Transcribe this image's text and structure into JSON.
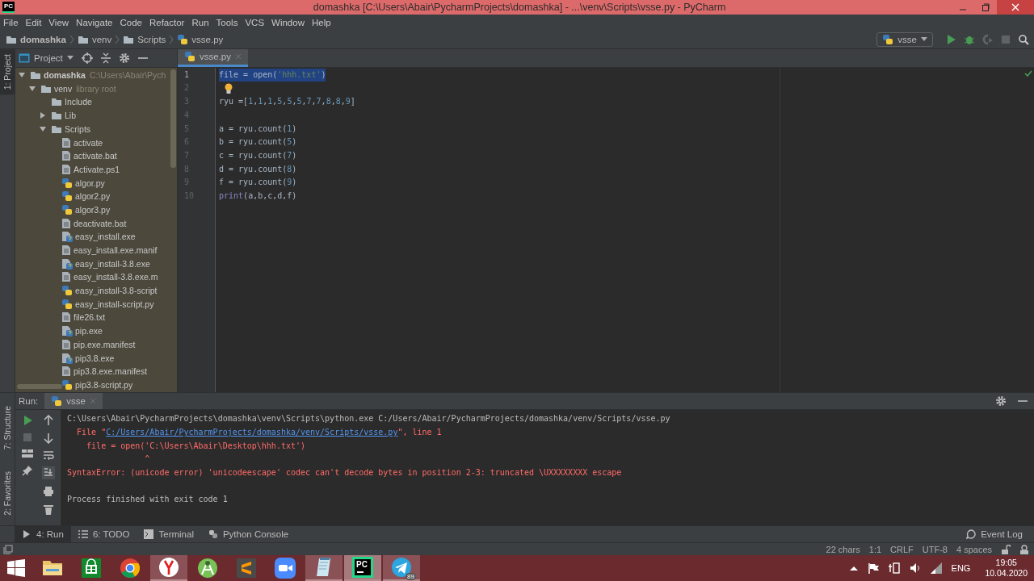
{
  "title_bar": {
    "app_label": "PC",
    "title": "domashka [C:\\Users\\Abair\\PycharmProjects\\domashka] - ...\\venv\\Scripts\\vsse.py - PyCharm"
  },
  "menu": [
    "File",
    "Edit",
    "View",
    "Navigate",
    "Code",
    "Refactor",
    "Run",
    "Tools",
    "VCS",
    "Window",
    "Help"
  ],
  "breadcrumb": [
    {
      "label": "domashka",
      "kind": "folder",
      "bold": true
    },
    {
      "label": "venv",
      "kind": "folder",
      "bold": false
    },
    {
      "label": "Scripts",
      "kind": "folder",
      "bold": false
    },
    {
      "label": "vsse.py",
      "kind": "python",
      "bold": false
    }
  ],
  "run_config": {
    "name": "vsse"
  },
  "side_tabs_top": [
    {
      "label": "1: Project",
      "selected": true
    }
  ],
  "project_panel": {
    "title": "Project",
    "tree": [
      {
        "label": "domashka",
        "kind": "folder",
        "bold": true,
        "note": "C:\\Users\\Abair\\Pych",
        "expanded": true,
        "children": [
          {
            "label": "venv",
            "kind": "folder",
            "bold": false,
            "note": "library root",
            "expanded": true,
            "children": [
              {
                "label": "Include",
                "kind": "folder",
                "bold": false
              },
              {
                "label": "Lib",
                "kind": "folder",
                "bold": false,
                "expanded": false
              },
              {
                "label": "Scripts",
                "kind": "folder",
                "bold": false,
                "expanded": true,
                "children": [
                  {
                    "label": "activate",
                    "kind": "text",
                    "bold": false
                  },
                  {
                    "label": "activate.bat",
                    "kind": "text",
                    "bold": false
                  },
                  {
                    "label": "Activate.ps1",
                    "kind": "text",
                    "bold": false
                  },
                  {
                    "label": "algor.py",
                    "kind": "python",
                    "bold": false
                  },
                  {
                    "label": "algor2.py",
                    "kind": "python",
                    "bold": false
                  },
                  {
                    "label": "algor3.py",
                    "kind": "python",
                    "bold": false
                  },
                  {
                    "label": "deactivate.bat",
                    "kind": "text",
                    "bold": false
                  },
                  {
                    "label": "easy_install.exe",
                    "kind": "exe",
                    "bold": false
                  },
                  {
                    "label": "easy_install.exe.manif",
                    "kind": "text",
                    "bold": false
                  },
                  {
                    "label": "easy_install-3.8.exe",
                    "kind": "exe",
                    "bold": false
                  },
                  {
                    "label": "easy_install-3.8.exe.m",
                    "kind": "text",
                    "bold": false
                  },
                  {
                    "label": "easy_install-3.8-script",
                    "kind": "python",
                    "bold": false
                  },
                  {
                    "label": "easy_install-script.py",
                    "kind": "python",
                    "bold": false
                  },
                  {
                    "label": "file26.txt",
                    "kind": "text",
                    "bold": false
                  },
                  {
                    "label": "pip.exe",
                    "kind": "exe",
                    "bold": false
                  },
                  {
                    "label": "pip.exe.manifest",
                    "kind": "text",
                    "bold": false
                  },
                  {
                    "label": "pip3.8.exe",
                    "kind": "exe",
                    "bold": false
                  },
                  {
                    "label": "pip3.8.exe.manifest",
                    "kind": "text",
                    "bold": false
                  },
                  {
                    "label": "pip3.8-script.py",
                    "kind": "python",
                    "bold": false
                  }
                ]
              }
            ]
          }
        ]
      }
    ]
  },
  "editor": {
    "tabs": [
      {
        "label": "vsse.py",
        "selected": true
      }
    ],
    "lines": [
      {
        "number": "1",
        "selected": true,
        "bulb": false,
        "segments": [
          {
            "text": "file = open(",
            "kind": "plain"
          },
          {
            "text": "'hhh.txt'",
            "kind": "string"
          },
          {
            "text": ")",
            "kind": "plain"
          }
        ]
      },
      {
        "number": "2",
        "selected": false,
        "bulb": true
      },
      {
        "number": "3",
        "selected": false,
        "bulb": false,
        "segments": [
          {
            "text": "ryu =[1,1,1,5,5,5,7,7,8,8,9]",
            "kind": "plain"
          }
        ]
      },
      {
        "number": "4",
        "selected": false,
        "bulb": false
      },
      {
        "number": "5",
        "selected": false,
        "bulb": false,
        "segments": [
          {
            "text": "a = ryu.count(1)",
            "kind": "plain"
          }
        ]
      },
      {
        "number": "6",
        "selected": false,
        "bulb": false,
        "segments": [
          {
            "text": "b = ryu.count(5)",
            "kind": "plain"
          }
        ]
      },
      {
        "number": "7",
        "selected": false,
        "bulb": false,
        "segments": [
          {
            "text": "c = ryu.count(7)",
            "kind": "plain"
          }
        ]
      },
      {
        "number": "8",
        "selected": false,
        "bulb": false,
        "segments": [
          {
            "text": "d = ryu.count(8)",
            "kind": "plain"
          }
        ]
      },
      {
        "number": "9",
        "selected": false,
        "bulb": false,
        "segments": [
          {
            "text": "f = ryu.count(9)",
            "kind": "plain"
          }
        ]
      },
      {
        "number": "10",
        "selected": false,
        "bulb": false,
        "segments": [
          {
            "text": "print",
            "kind": "builtin"
          },
          {
            "text": "(a,b,c,d,f)",
            "kind": "plain"
          }
        ]
      }
    ]
  },
  "run_panel": {
    "label": "Run:",
    "tabs": [
      {
        "label": "vsse",
        "selected": true
      }
    ],
    "output": [
      {
        "kind": "plain",
        "segments": [
          {
            "text": "C:\\Users\\Abair\\PycharmProjects\\domashka\\venv\\Scripts\\python.exe C:/Users/Abair/PycharmProjects/domashka/venv/Scripts/vsse.py",
            "link": false
          }
        ]
      },
      {
        "kind": "error",
        "segments": [
          {
            "text": "  File \"",
            "link": false
          },
          {
            "text": "C:/Users/Abair/PycharmProjects/domashka/venv/Scripts/vsse.py",
            "link": true
          },
          {
            "text": "\", line 1",
            "link": false
          }
        ]
      },
      {
        "kind": "error",
        "segments": [
          {
            "text": "    file = open('C:\\Users\\Abair\\Desktop\\hhh.txt')",
            "link": false
          }
        ]
      },
      {
        "kind": "error",
        "segments": [
          {
            "text": "                ^",
            "link": false
          }
        ]
      },
      {
        "kind": "error",
        "segments": [
          {
            "text": "SyntaxError: (unicode error) 'unicodeescape' codec can't decode bytes in position 2-3: truncated \\UXXXXXXXX escape",
            "link": false
          }
        ]
      },
      {
        "kind": "blank"
      },
      {
        "kind": "plain",
        "segments": [
          {
            "text": "Process finished with exit code 1",
            "link": false
          }
        ]
      }
    ]
  },
  "side_tabs_bottom": [
    {
      "label": "7: Structure",
      "selected": false
    },
    {
      "label": "2: Favorites",
      "selected": false
    }
  ],
  "tool_tabs": [
    {
      "label": "4: Run",
      "kind": "run",
      "selected": true
    },
    {
      "label": "6: TODO",
      "kind": "todo",
      "selected": false
    },
    {
      "label": "Terminal",
      "kind": "terminal",
      "selected": false
    },
    {
      "label": "Python Console",
      "kind": "console",
      "selected": false
    }
  ],
  "event_log": "Event Log",
  "status_bar": [
    "22 chars",
    "1:1",
    "CRLF",
    "UTF-8",
    "4 spaces"
  ],
  "taskbar": {
    "apps": [
      {
        "kind": "explorer",
        "running": false,
        "selected": false
      },
      {
        "kind": "store",
        "running": false,
        "selected": false
      },
      {
        "kind": "chrome",
        "running": false,
        "selected": false
      },
      {
        "kind": "yandex",
        "running": true,
        "selected": false
      },
      {
        "kind": "android",
        "running": false,
        "selected": false
      },
      {
        "kind": "sublime",
        "running": false,
        "selected": false
      },
      {
        "kind": "zoom",
        "running": false,
        "selected": false
      },
      {
        "kind": "notepad",
        "running": true,
        "selected": false
      },
      {
        "kind": "pycharm",
        "running": true,
        "selected": true,
        "label": "PC"
      },
      {
        "kind": "telegram",
        "running": true,
        "selected": false,
        "badge": "89"
      }
    ],
    "tray": {
      "language": "ENG",
      "time": "19:05",
      "date": "10.04.2020"
    }
  }
}
